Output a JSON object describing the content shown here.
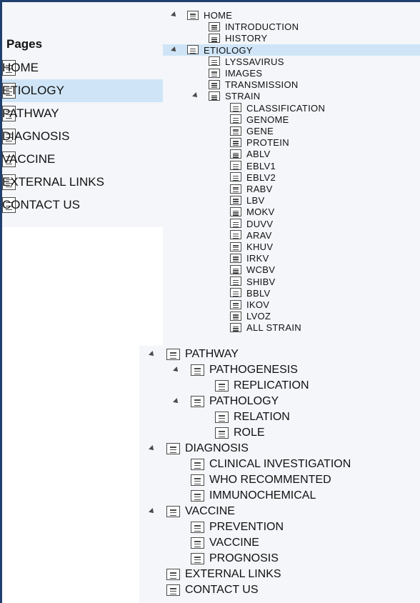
{
  "sidebar": {
    "title": "Pages",
    "items": [
      {
        "label": "HOME",
        "expander": "collapsed",
        "selected": false
      },
      {
        "label": "ETIOLOGY",
        "expander": "collapsed",
        "selected": true
      },
      {
        "label": "PATHWAY",
        "expander": "collapsed",
        "selected": false
      },
      {
        "label": "DIAGNOSIS",
        "expander": "collapsed",
        "selected": false
      },
      {
        "label": "VACCINE",
        "expander": "collapsed",
        "selected": false
      },
      {
        "label": "EXTERNAL LINKS",
        "expander": "none",
        "selected": false
      },
      {
        "label": "CONTACT US",
        "expander": "none",
        "selected": false
      }
    ]
  },
  "tree_top": [
    {
      "label": "HOME",
      "level": 0,
      "expander": "expanded",
      "selected": false
    },
    {
      "label": "INTRODUCTION",
      "level": 1,
      "expander": "none",
      "selected": false
    },
    {
      "label": "HISTORY",
      "level": 1,
      "expander": "none",
      "selected": false
    },
    {
      "label": "ETIOLOGY",
      "level": 0,
      "expander": "expanded",
      "selected": true
    },
    {
      "label": "LYSSAVIRUS",
      "level": 1,
      "expander": "none",
      "selected": false
    },
    {
      "label": "IMAGES",
      "level": 1,
      "expander": "none",
      "selected": false
    },
    {
      "label": "TRANSMISSION",
      "level": 1,
      "expander": "none",
      "selected": false
    },
    {
      "label": "STRAIN",
      "level": 1,
      "expander": "expanded",
      "selected": false
    },
    {
      "label": "CLASSIFICATION",
      "level": 2,
      "expander": "none",
      "selected": false
    },
    {
      "label": "GENOME",
      "level": 2,
      "expander": "none",
      "selected": false
    },
    {
      "label": "GENE",
      "level": 2,
      "expander": "none",
      "selected": false
    },
    {
      "label": "PROTEIN",
      "level": 2,
      "expander": "none",
      "selected": false
    },
    {
      "label": "ABLV",
      "level": 2,
      "expander": "none",
      "selected": false
    },
    {
      "label": "EBLV1",
      "level": 2,
      "expander": "none",
      "selected": false
    },
    {
      "label": "EBLV2",
      "level": 2,
      "expander": "none",
      "selected": false
    },
    {
      "label": "RABV",
      "level": 2,
      "expander": "none",
      "selected": false
    },
    {
      "label": "LBV",
      "level": 2,
      "expander": "none",
      "selected": false
    },
    {
      "label": "MOKV",
      "level": 2,
      "expander": "none",
      "selected": false
    },
    {
      "label": "DUVV",
      "level": 2,
      "expander": "none",
      "selected": false
    },
    {
      "label": "ARAV",
      "level": 2,
      "expander": "none",
      "selected": false
    },
    {
      "label": "KHUV",
      "level": 2,
      "expander": "none",
      "selected": false
    },
    {
      "label": "IRKV",
      "level": 2,
      "expander": "none",
      "selected": false
    },
    {
      "label": "WCBV",
      "level": 2,
      "expander": "none",
      "selected": false
    },
    {
      "label": "SHIBV",
      "level": 2,
      "expander": "none",
      "selected": false
    },
    {
      "label": "BBLV",
      "level": 2,
      "expander": "none",
      "selected": false
    },
    {
      "label": "IKOV",
      "level": 2,
      "expander": "none",
      "selected": false
    },
    {
      "label": "LVOZ",
      "level": 2,
      "expander": "none",
      "selected": false
    },
    {
      "label": "ALL STRAIN",
      "level": 2,
      "expander": "none",
      "selected": false
    }
  ],
  "tree_bottom": [
    {
      "label": "PATHWAY",
      "level": 0,
      "expander": "expanded",
      "selected": false
    },
    {
      "label": "PATHOGENESIS",
      "level": 1,
      "expander": "expanded",
      "selected": false
    },
    {
      "label": "REPLICATION",
      "level": 2,
      "expander": "none",
      "selected": false
    },
    {
      "label": "PATHOLOGY",
      "level": 1,
      "expander": "expanded",
      "selected": false
    },
    {
      "label": "RELATION",
      "level": 2,
      "expander": "none",
      "selected": false
    },
    {
      "label": "ROLE",
      "level": 2,
      "expander": "none",
      "selected": false
    },
    {
      "label": "DIAGNOSIS",
      "level": 0,
      "expander": "expanded",
      "selected": false
    },
    {
      "label": "CLINICAL INVESTIGATION",
      "level": 1,
      "expander": "none",
      "selected": false
    },
    {
      "label": "WHO RECOMMENTED",
      "level": 1,
      "expander": "none",
      "selected": false
    },
    {
      "label": "IMMUNOCHEMICAL",
      "level": 1,
      "expander": "none",
      "selected": false
    },
    {
      "label": "VACCINE",
      "level": 0,
      "expander": "expanded",
      "selected": false
    },
    {
      "label": "PREVENTION",
      "level": 1,
      "expander": "none",
      "selected": false
    },
    {
      "label": "VACCINE",
      "level": 1,
      "expander": "none",
      "selected": false
    },
    {
      "label": "PROGNOSIS",
      "level": 1,
      "expander": "none",
      "selected": false
    },
    {
      "label": "EXTERNAL LINKS",
      "level": 0,
      "expander": "none",
      "selected": false
    },
    {
      "label": "CONTACT US",
      "level": 0,
      "expander": "none",
      "selected": false
    }
  ],
  "colors": {
    "border": "#1f3f6e",
    "panel_bg": "#f4f6f9",
    "selection": "#cfe5f7",
    "text": "#111111"
  }
}
